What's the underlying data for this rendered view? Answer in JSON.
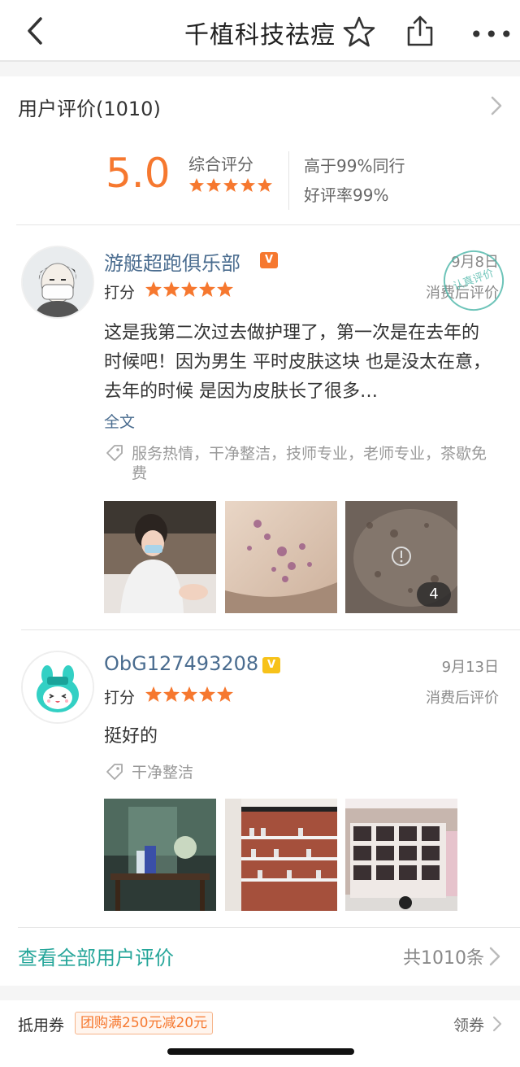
{
  "header": {
    "title": "千植科技祛痘",
    "back_icon": "chevron-left-icon",
    "favorite_icon": "star-outline-icon",
    "share_icon": "share-icon",
    "more_label": "•••"
  },
  "reviews_section": {
    "heading": "用户评价(1010)",
    "score": "5.0",
    "score_label": "综合评分",
    "score_stars": 5,
    "stat_higher": "高于99%同行",
    "stat_good_rate": "好评率99%",
    "accent_color": "#f6782f",
    "items": [
      {
        "username": "游艇超跑俱乐部",
        "date": "9月8日",
        "post_label": "消费后评价",
        "rating_label": "打分",
        "rating": 5,
        "stamp_text": "认真评价",
        "text": "这是我第二次过去做护理了，第一次是在去年的时候吧！因为男生 平时皮肤这块 也是没太在意，去年的时候 是因为皮肤长了很多…",
        "full_text_label": "全文",
        "tags": "服务热情，干净整洁，技师专业，老师专业，茶歇免费",
        "more_photos_count": "4"
      },
      {
        "username": "ObG127493208",
        "date": "9月13日",
        "post_label": "消费后评价",
        "rating_label": "打分",
        "rating": 5,
        "text": "挺好的",
        "tags": "干净整洁"
      }
    ],
    "view_all_label": "查看全部用户评价",
    "total_label": "共1010条"
  },
  "coupon": {
    "label": "抵用券",
    "tag": "团购满250元减20元",
    "action": "领券"
  }
}
